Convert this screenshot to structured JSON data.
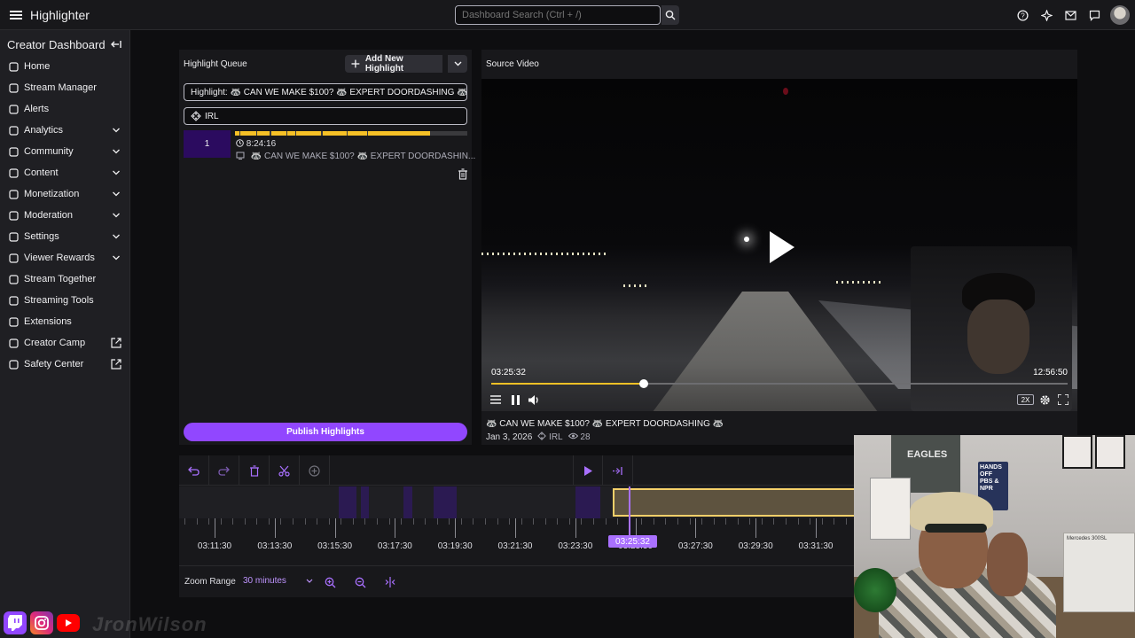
{
  "topbar": {
    "app_title": "Highlighter",
    "search_placeholder": "Dashboard Search (Ctrl + /)",
    "icons": [
      "help-icon",
      "sparkle-icon",
      "mail-icon",
      "chat-icon",
      "avatar"
    ]
  },
  "sidebar": {
    "title": "Creator Dashboard",
    "items": [
      {
        "label": "Home",
        "icon": "home-icon",
        "tail": ""
      },
      {
        "label": "Stream Manager",
        "icon": "stream-manager-icon",
        "tail": ""
      },
      {
        "label": "Alerts",
        "icon": "bell-icon",
        "tail": ""
      },
      {
        "label": "Analytics",
        "icon": "analytics-icon",
        "tail": "chevron"
      },
      {
        "label": "Community",
        "icon": "community-icon",
        "tail": "chevron"
      },
      {
        "label": "Content",
        "icon": "content-icon",
        "tail": "chevron"
      },
      {
        "label": "Monetization",
        "icon": "monetization-icon",
        "tail": "chevron"
      },
      {
        "label": "Moderation",
        "icon": "moderation-icon",
        "tail": "chevron"
      },
      {
        "label": "Settings",
        "icon": "gear-icon",
        "tail": "chevron"
      },
      {
        "label": "Viewer Rewards",
        "icon": "rewards-icon",
        "tail": "chevron"
      },
      {
        "label": "Stream Together",
        "icon": "stream-together-icon",
        "tail": ""
      },
      {
        "label": "Streaming Tools",
        "icon": "tools-icon",
        "tail": ""
      },
      {
        "label": "Extensions",
        "icon": "extensions-icon",
        "tail": ""
      },
      {
        "label": "Creator Camp",
        "icon": "camp-icon",
        "tail": "external"
      },
      {
        "label": "Safety Center",
        "icon": "shield-icon",
        "tail": "external"
      }
    ]
  },
  "queue": {
    "heading": "Highlight Queue",
    "add_label": "Add New Highlight",
    "title_field": "Highlight: 🦝 CAN WE MAKE $100? 🦝 EXPERT DOORDASHING 🦝",
    "category_field": "IRL",
    "clip": {
      "number": "1",
      "duration": "8:24:16",
      "title": "🦝 CAN WE MAKE $100? 🦝 EXPERT DOORDASHIN..."
    },
    "publish_label": "Publish Highlights"
  },
  "source": {
    "heading": "Source Video",
    "current_time": "03:25:32",
    "total_time": "12:56:50",
    "progress": 0.265,
    "speed": "2X",
    "title": "🦝 CAN WE MAKE $100? 🦝 EXPERT DOORDASHING 🦝",
    "date": "Jan 3, 2026",
    "category": "IRL",
    "views": "28"
  },
  "timeline": {
    "ticks": [
      "03:11:30",
      "03:13:30",
      "03:15:30",
      "03:17:30",
      "03:19:30",
      "03:21:30",
      "03:23:30",
      "03:25:30",
      "03:27:30",
      "03:29:30",
      "03:31:30"
    ],
    "playhead_label": "03:25:32",
    "zoom_label": "Zoom Range",
    "zoom_value": "30 minutes"
  },
  "webcam": {
    "poster_text": "EAGLES",
    "poster2_text": "HANDS OFF PBS & NPR",
    "box_text": "Mercedes 300SL"
  },
  "footer": {
    "watermark": "JronWilson"
  },
  "colors": {
    "accent": "#9147ff",
    "highlight": "#f5c026",
    "twitch": "#9146ff",
    "instagram": "#e1306c",
    "youtube": "#ff0000"
  }
}
